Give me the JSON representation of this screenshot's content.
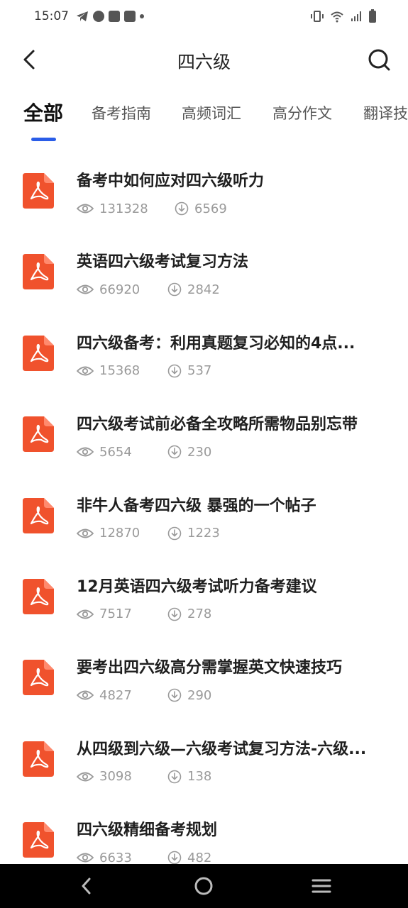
{
  "status": {
    "time": "15:07"
  },
  "header": {
    "title": "四六级"
  },
  "tabs": [
    {
      "label": "全部",
      "active": true
    },
    {
      "label": "备考指南"
    },
    {
      "label": "高频词汇"
    },
    {
      "label": "高分作文"
    },
    {
      "label": "翻译技"
    }
  ],
  "items": [
    {
      "title": "备考中如何应对四六级听力",
      "views": "131328",
      "downloads": "6569"
    },
    {
      "title": "英语四六级考试复习方法",
      "views": "66920",
      "downloads": "2842"
    },
    {
      "title": "四六级备考：利用真题复习必知的4点...",
      "views": "15368",
      "downloads": "537"
    },
    {
      "title": "四六级考试前必备全攻略所需物品别忘带",
      "views": "5654",
      "downloads": "230"
    },
    {
      "title": "非牛人备考四六级 暴强的一个帖子",
      "views": "12870",
      "downloads": "1223"
    },
    {
      "title": "12月英语四六级考试听力备考建议",
      "views": "7517",
      "downloads": "278"
    },
    {
      "title": "要考出四六级高分需掌握英文快速技巧",
      "views": "4827",
      "downloads": "290"
    },
    {
      "title": "从四级到六级—六级考试复习方法-六级...",
      "views": "3098",
      "downloads": "138"
    },
    {
      "title": "四六级精细备考规划",
      "views": "6633",
      "downloads": "482"
    }
  ],
  "colors": {
    "accent": "#2a5de8",
    "pdf": "#f0522d"
  }
}
